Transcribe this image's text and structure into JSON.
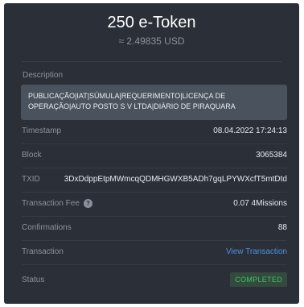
{
  "header": {
    "amount": "250 e-Token",
    "fiat": "≈ 2.49835 USD"
  },
  "description": {
    "label": "Description",
    "text": "PUBLICAÇÃO|IAT|SÚMULA|REQUERIMENTO|LICENÇA DE OPERAÇÃO|AUTO POSTO S V LTDA|DIÁRIO DE PIRAQUARA"
  },
  "rows": {
    "timestamp": {
      "label": "Timestamp",
      "value": "08.04.2022 17:24:13"
    },
    "block": {
      "label": "Block",
      "value": "3065384"
    },
    "txid": {
      "label": "TXID",
      "value": "3DxDdppEtpMWmcqQDMHGWXB5ADh7gqLPYWXcfT5mtDtd"
    },
    "fee": {
      "label": "Transaction Fee",
      "value": "0.07 4Missions"
    },
    "confirmations": {
      "label": "Confirmations",
      "value": "88"
    },
    "transaction": {
      "label": "Transaction",
      "link": "View Transaction"
    },
    "status": {
      "label": "Status",
      "value": "COMPLETED"
    }
  },
  "colors": {
    "panel_bg": "#2b3038",
    "link": "#4d8fe0",
    "status_completed": "#3cc36b"
  },
  "icons": {
    "fee_help": "question-circle-icon"
  }
}
